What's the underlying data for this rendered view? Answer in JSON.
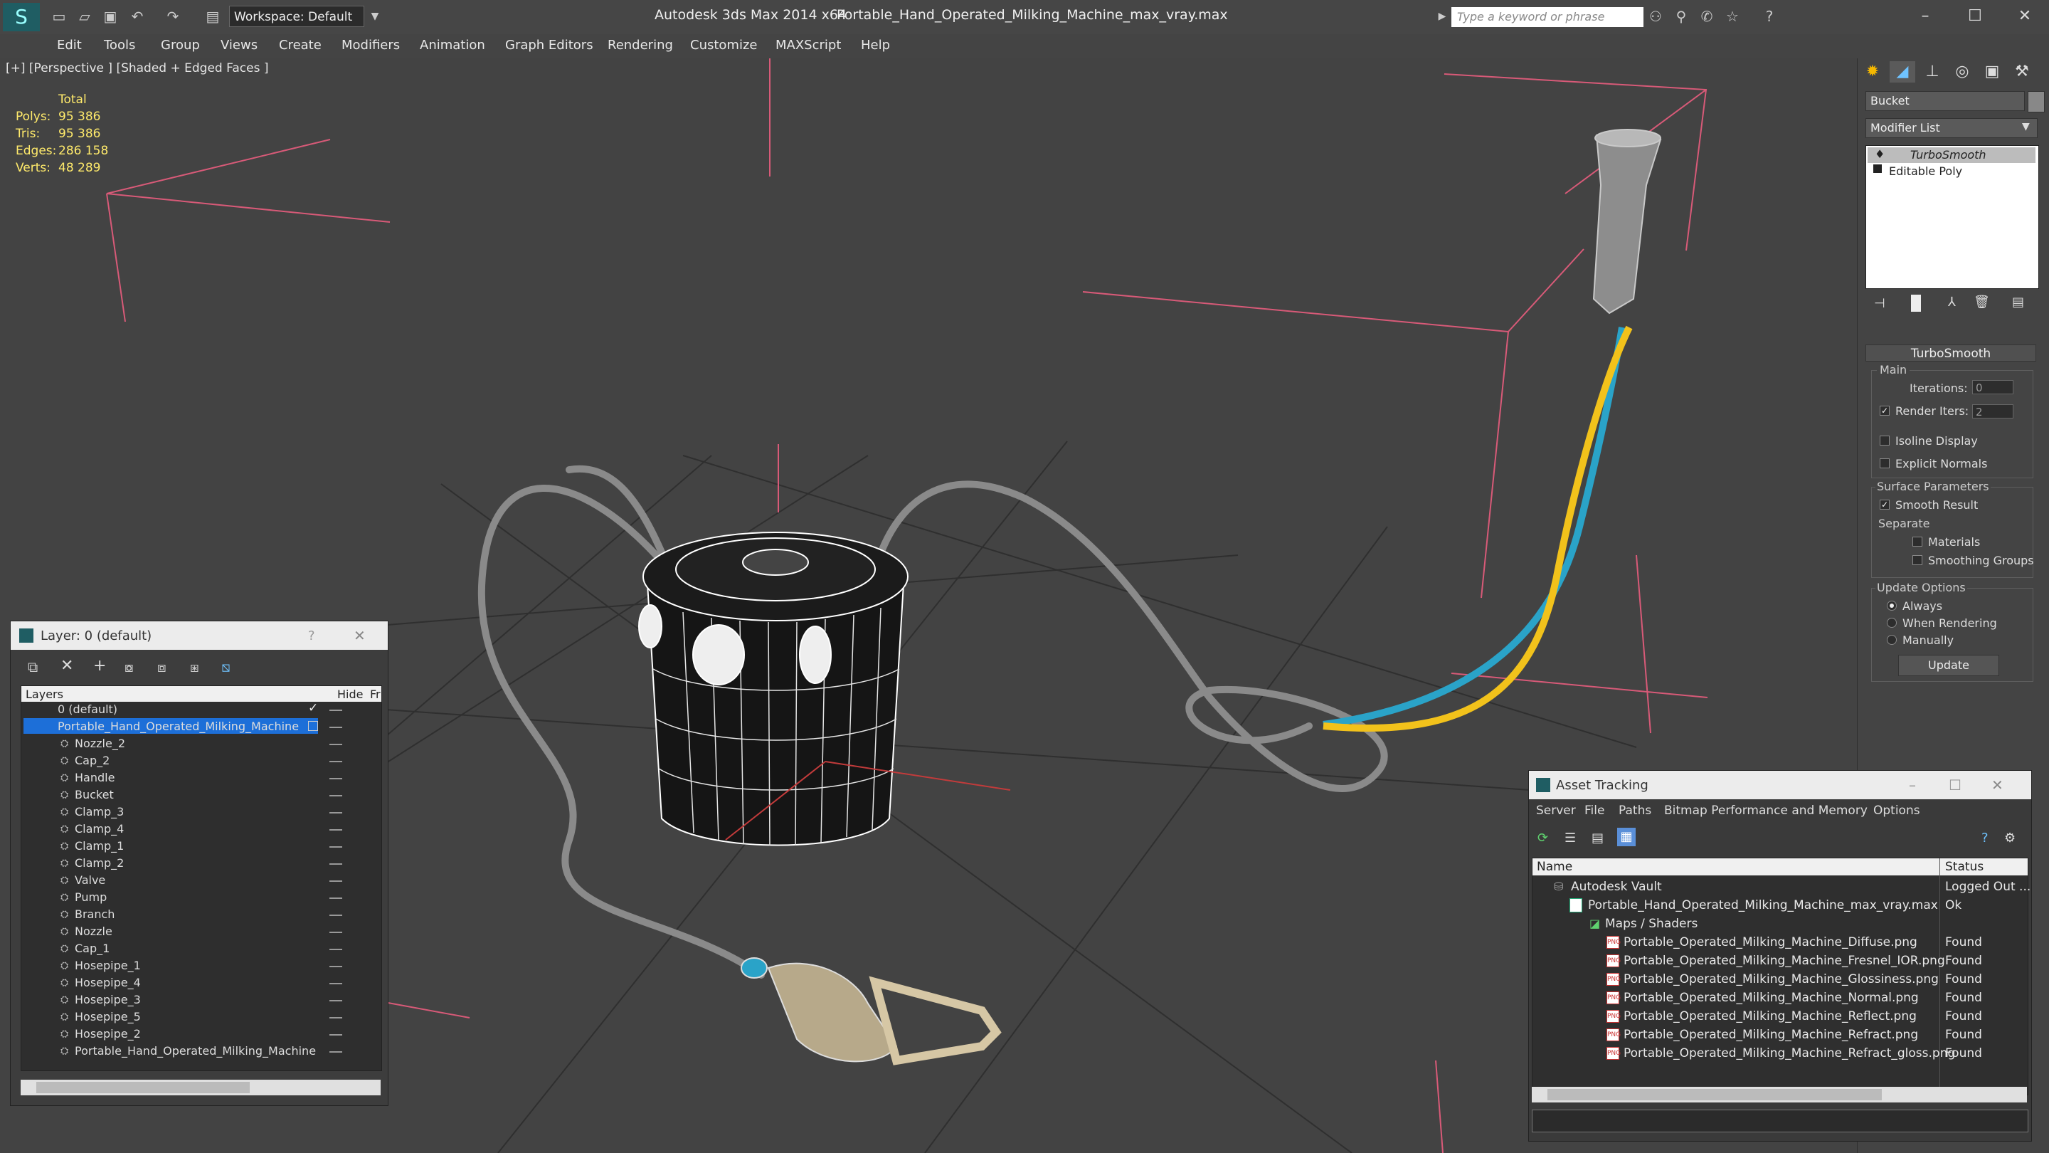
{
  "titlebar": {
    "app": "Autodesk 3ds Max  2014 x64",
    "file": "Portable_Hand_Operated_Milking_Machine_max_vray.max",
    "workspace": "Workspace: Default",
    "search_placeholder": "Type a keyword or phrase"
  },
  "menu": [
    "Edit",
    "Tools",
    "Group",
    "Views",
    "Create",
    "Modifiers",
    "Animation",
    "Graph Editors",
    "Rendering",
    "Customize",
    "MAXScript",
    "Help"
  ],
  "viewport": {
    "label": "[+] [Perspective ] [Shaded + Edged Faces ]",
    "stats": {
      "header": "Total",
      "rows": [
        {
          "label": "Polys:",
          "value": "95 386"
        },
        {
          "label": "Tris:",
          "value": "95 386"
        },
        {
          "label": "Edges:",
          "value": "286 158"
        },
        {
          "label": "Verts:",
          "value": "48 289"
        }
      ]
    }
  },
  "command_panel": {
    "object_name": "Bucket",
    "modifier_list": "Modifier List",
    "stack": [
      "TurboSmooth",
      "Editable Poly"
    ],
    "rollout": "TurboSmooth",
    "main_label": "Main",
    "iterations_label": "Iterations:",
    "iterations_value": "0",
    "render_iters_label": "Render Iters:",
    "render_iters_value": "2",
    "isoline": "Isoline Display",
    "explicit_normals": "Explicit Normals",
    "surface_params": "Surface Parameters",
    "smooth_result": "Smooth Result",
    "separate": "Separate",
    "materials": "Materials",
    "smoothing_groups": "Smoothing Groups",
    "update_options": "Update Options",
    "always": "Always",
    "when_rendering": "When Rendering",
    "manually": "Manually",
    "update_button": "Update"
  },
  "layer_window": {
    "title": "Layer: 0 (default)",
    "col_layers": "Layers",
    "col_hide": "Hide",
    "col_fr": "Fr",
    "default_layer": "0 (default)",
    "active_layer": "Portable_Hand_Operated_Milking_Machine",
    "objects": [
      "Nozzle_2",
      "Cap_2",
      "Handle",
      "Bucket",
      "Clamp_3",
      "Clamp_4",
      "Clamp_1",
      "Clamp_2",
      "Valve",
      "Pump",
      "Branch",
      "Nozzle",
      "Cap_1",
      "Hosepipe_1",
      "Hosepipe_4",
      "Hosepipe_3",
      "Hosepipe_5",
      "Hosepipe_2",
      "Portable_Hand_Operated_Milking_Machine"
    ]
  },
  "asset_tracking": {
    "title": "Asset Tracking",
    "menu": [
      "Server",
      "File",
      "Paths",
      "Bitmap Performance and Memory",
      "Options"
    ],
    "col_name": "Name",
    "col_status": "Status",
    "vault": {
      "name": "Autodesk Vault",
      "status": "Logged Out ..."
    },
    "max_file": {
      "name": "Portable_Hand_Operated_Milking_Machine_max_vray.max",
      "status": "Ok"
    },
    "maps_folder": "Maps / Shaders",
    "maps": [
      {
        "name": "Portable_Operated_Milking_Machine_Diffuse.png",
        "status": "Found"
      },
      {
        "name": "Portable_Operated_Milking_Machine_Fresnel_IOR.png",
        "status": "Found"
      },
      {
        "name": "Portable_Operated_Milking_Machine_Glossiness.png",
        "status": "Found"
      },
      {
        "name": "Portable_Operated_Milking_Machine_Normal.png",
        "status": "Found"
      },
      {
        "name": "Portable_Operated_Milking_Machine_Reflect.png",
        "status": "Found"
      },
      {
        "name": "Portable_Operated_Milking_Machine_Refract.png",
        "status": "Found"
      },
      {
        "name": "Portable_Operated_Milking_Machine_Refract_gloss.png",
        "status": "Found"
      }
    ]
  },
  "colors": {
    "accent": "#1d6fd8",
    "stats_yellow": "#ffea6b",
    "bbox_pink": "#d85a78",
    "hose_yellow": "#f2c21b",
    "hose_blue": "#2aa3c8"
  }
}
